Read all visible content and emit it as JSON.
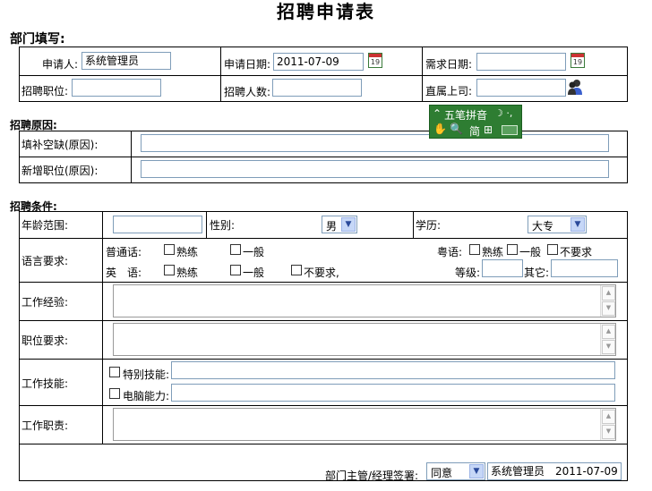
{
  "page": {
    "title": "招聘申请表"
  },
  "dept": {
    "heading": "部门填写:",
    "applicant_label": "申请人:",
    "applicant_value": "系统管理员",
    "apply_date_label": "申请日期:",
    "apply_date_value": "2011-07-09",
    "need_date_label": "需求日期:",
    "need_date_value": "",
    "position_label": "招聘职位:",
    "count_label": "招聘人数:",
    "superior_label": "直属上司:",
    "calendar_day": "19"
  },
  "reason": {
    "heading": "招聘原因:",
    "fill_label": "填补空缺(原因):",
    "new_label": "新增职位(原因):"
  },
  "ime": {
    "top_label": "五笔拼音",
    "bottom_label": "简"
  },
  "cond": {
    "heading": "招聘条件:",
    "age_label": "年龄范围:",
    "gender_label": "性别:",
    "gender_value": "男",
    "edu_label": "学历:",
    "edu_value": "大专",
    "lang_label": "语言要求:",
    "mandarin_label": "普通话:",
    "cantonese_label": "粤语:",
    "english_label": "英　语:",
    "opt_fluent": "熟练",
    "opt_general": "一般",
    "opt_none": "不要求",
    "opt_none_comma": "不要求,",
    "level_label": "等级:",
    "other_label": "其它:",
    "exp_label": "工作经验:",
    "req_label": "职位要求:",
    "skill_label": "工作技能:",
    "special_skill_label": "特别技能:",
    "computer_label": "电脑能力:",
    "duty_label": "工作职责:"
  },
  "footer": {
    "signer_label": "部门主管/经理签署:",
    "approval_value": "同意",
    "signer_value": "系统管理员　2011-07-09"
  }
}
